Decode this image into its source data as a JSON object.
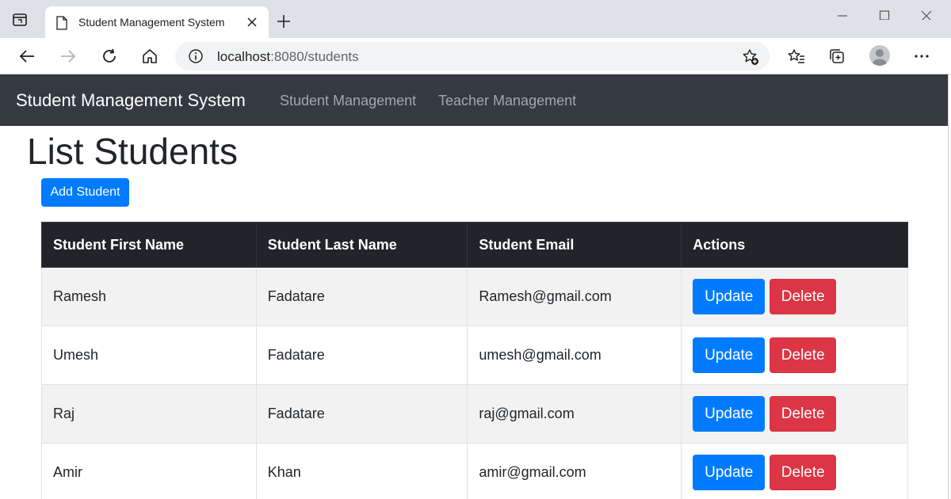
{
  "browser": {
    "tab_title": "Student Management System",
    "url_host": "localhost",
    "url_path": ":8080/students"
  },
  "colors": {
    "navbar": "#343a40",
    "primary": "#007bff",
    "danger": "#dc3545",
    "table_header": "#212529"
  },
  "navbar": {
    "brand": "Student Management System",
    "links": [
      "Student Management",
      "Teacher Management"
    ]
  },
  "main": {
    "heading": "List Students",
    "add_button": "Add Student",
    "table": {
      "headers": [
        "Student First Name",
        "Student Last Name",
        "Student Email",
        "Actions"
      ],
      "rows": [
        {
          "first": "Ramesh",
          "last": "Fadatare",
          "email": "Ramesh@gmail.com"
        },
        {
          "first": "Umesh",
          "last": "Fadatare",
          "email": "umesh@gmail.com"
        },
        {
          "first": "Raj",
          "last": "Fadatare",
          "email": "raj@gmail.com"
        },
        {
          "first": "Amir",
          "last": "Khan",
          "email": "amir@gmail.com"
        }
      ],
      "update_label": "Update",
      "delete_label": "Delete"
    }
  }
}
